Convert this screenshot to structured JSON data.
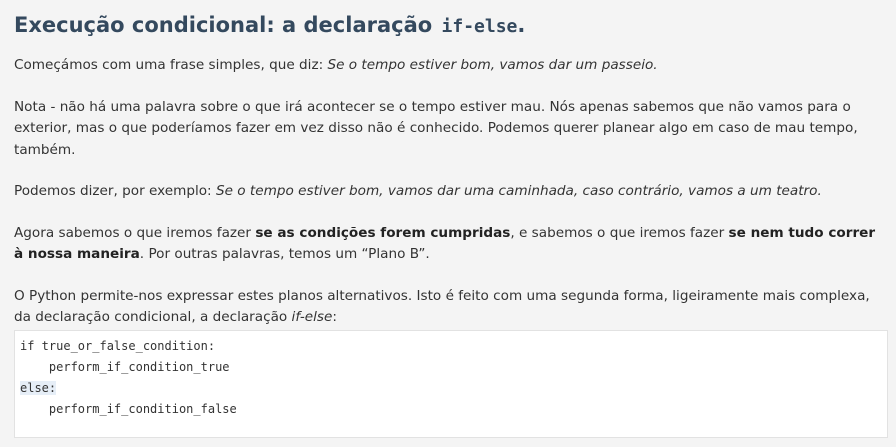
{
  "heading": {
    "text": "Execução condicional: a declaração",
    "code": "if-else",
    "suffix": "."
  },
  "paragraphs": {
    "p1": {
      "text": "Começámos com uma frase simples, que diz: ",
      "em": "Se o tempo estiver bom, vamos dar um passeio."
    },
    "p2": {
      "text": "Nota - não há uma palavra sobre o que irá acontecer se o tempo estiver mau. Nós apenas sabemos que não vamos para o exterior, mas o que poderíamos fazer em vez disso não é conhecido. Podemos querer planear algo em caso de mau tempo, também."
    },
    "p3": {
      "text": "Podemos dizer, por exemplo: ",
      "em": "Se o tempo estiver bom, vamos dar uma caminhada, caso contrário, vamos a um teatro."
    },
    "p4": {
      "text_a": "Agora sabemos o que iremos fazer ",
      "strong_a": "se as condições forem cumpridas",
      "text_b": ", e sabemos o que iremos fazer ",
      "strong_b": "se nem tudo correr à nossa maneira",
      "text_c": ". Por outras palavras, temos um “Plano B”."
    },
    "p5": {
      "text": "O Python permite-nos expressar estes planos alternativos. Isto é feito com uma segunda forma, ligeiramente mais complexa, da declaração condicional, a declaração ",
      "em": "if-else",
      "suffix": ":"
    }
  },
  "code": {
    "lines": [
      "if true_or_false_condition:",
      "    perform_if_condition_true",
      "else:",
      "    perform_if_condition_false"
    ]
  }
}
